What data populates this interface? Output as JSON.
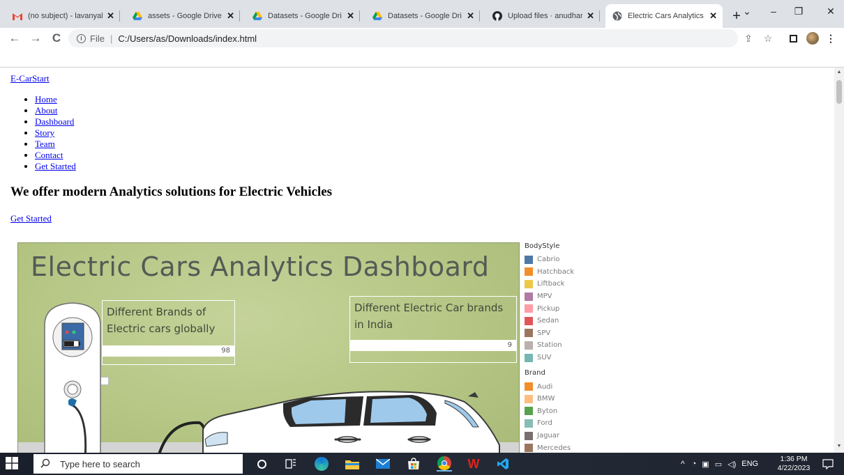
{
  "browser": {
    "tabs": [
      {
        "title": "(no subject) - lavanyal",
        "favicon": "gmail-icon",
        "active": false
      },
      {
        "title": "assets - Google Drive",
        "favicon": "google-drive-icon",
        "active": false
      },
      {
        "title": "Datasets - Google Dri",
        "favicon": "google-drive-icon",
        "active": false
      },
      {
        "title": "Datasets - Google Dri",
        "favicon": "google-drive-icon",
        "active": false
      },
      {
        "title": "Upload files · anudhar",
        "favicon": "github-icon",
        "active": false
      },
      {
        "title": "Electric Cars Analytics",
        "favicon": "globe-icon",
        "active": true
      }
    ],
    "new_tab_label": "+",
    "address": {
      "protocol_label": "File",
      "url": "C:/Users/as/Downloads/index.html"
    }
  },
  "page": {
    "brand": "E-CarStart",
    "nav": [
      "Home",
      "About",
      "Dashboard",
      "Story",
      "Team",
      "Contact",
      "Get Started"
    ],
    "hero_title": "We offer modern Analytics solutions for Electric Vehicles",
    "hero_cta": "Get Started"
  },
  "dashboard": {
    "title": "Electric Cars Analytics Dashboard",
    "kpis": [
      {
        "label": "Different Brands of Electric cars globally",
        "value": "98"
      },
      {
        "label": "Different Electric Car brands in India",
        "value": "9"
      }
    ],
    "legend": {
      "bodystyle_title": "BodyStyle",
      "bodystyle": [
        {
          "name": "Cabrio",
          "color": "#4e79a7"
        },
        {
          "name": "Hatchback",
          "color": "#f28e2b"
        },
        {
          "name": "Liftback",
          "color": "#edc948"
        },
        {
          "name": "MPV",
          "color": "#b07aa1"
        },
        {
          "name": "Pickup",
          "color": "#ff9da7"
        },
        {
          "name": "Sedan",
          "color": "#e15759"
        },
        {
          "name": "SPV",
          "color": "#9c755f"
        },
        {
          "name": "Station",
          "color": "#bab0ac"
        },
        {
          "name": "SUV",
          "color": "#76b7b2"
        }
      ],
      "brand_title": "Brand",
      "brand": [
        {
          "name": "Audi",
          "color": "#f28e2b"
        },
        {
          "name": "BMW",
          "color": "#ffbe7d"
        },
        {
          "name": "Byton",
          "color": "#59a14f"
        },
        {
          "name": "Ford",
          "color": "#86bcb6"
        },
        {
          "name": "Jaguar",
          "color": "#79706e"
        },
        {
          "name": "Mercedes",
          "color": "#9c755f"
        }
      ]
    }
  },
  "taskbar": {
    "search_placeholder": "Type here to search",
    "language": "ENG",
    "time": "1:36 PM",
    "date": "4/22/2023"
  }
}
